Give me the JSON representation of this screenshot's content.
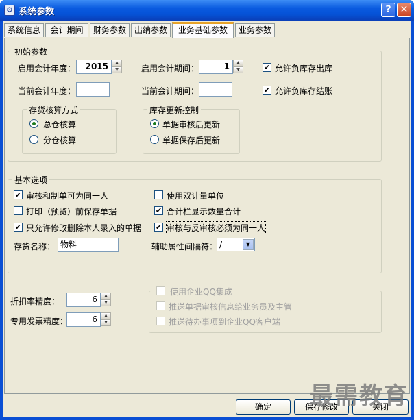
{
  "window": {
    "title": "系统参数",
    "help_glyph": "?",
    "close_glyph": "✕",
    "app_icon_glyph": "⚙"
  },
  "tabs": [
    {
      "label": "系统信息"
    },
    {
      "label": "会计期间"
    },
    {
      "label": "财务参数"
    },
    {
      "label": "出纳参数"
    },
    {
      "label": "业务基础参数",
      "active": true
    },
    {
      "label": "业务参数"
    }
  ],
  "initial": {
    "legend": "初始参数",
    "start_year_label": "启用会计年度：",
    "start_year_value": "2015",
    "start_period_label": "启用会计期间：",
    "start_period_value": "1",
    "current_year_label": "当前会计年度：",
    "current_year_value": "",
    "current_period_label": "当前会计期间：",
    "current_period_value": "",
    "allow_negative_out": {
      "label": "允许负库存出库",
      "checked": true
    },
    "allow_negative_close": {
      "label": "允许负库存结账",
      "checked": true
    },
    "costing": {
      "legend": "存货核算方式",
      "option1": "总仓核算",
      "option2": "分仓核算",
      "selected": "总仓核算"
    },
    "stock_update": {
      "legend": "库存更新控制",
      "option1": "单据审核后更新",
      "option2": "单据保存后更新",
      "selected": "单据审核后更新"
    }
  },
  "basic": {
    "legend": "基本选项",
    "opt_same_person": {
      "label": "审核和制单可为同一人",
      "checked": true
    },
    "opt_dual_unit": {
      "label": "使用双计量单位",
      "checked": false
    },
    "opt_print_save": {
      "label": "打印（预览）前保存单据",
      "checked": false
    },
    "opt_total_qty": {
      "label": "合计栏显示数量合计",
      "checked": true
    },
    "opt_own_docs": {
      "label": "只允许修改删除本人录入的单据",
      "checked": true
    },
    "opt_review_same": {
      "label": "审核与反审核必须为同一人",
      "checked": true
    },
    "inventory_name_label": "存货名称：",
    "inventory_name_value": "物料",
    "separator_label": "辅助属性间隔符：",
    "separator_value": "/"
  },
  "precision": {
    "discount_label": "折扣率精度：",
    "discount_value": "6",
    "invoice_label": "专用发票精度：",
    "invoice_value": "6"
  },
  "qq": {
    "use_qq": {
      "label": "使用企业QQ集成",
      "checked": false
    },
    "push_audit": {
      "label": "推送单据审核信息给业务员及主管",
      "checked": false
    },
    "push_todo": {
      "label": "推送待办事项到企业QQ客户端",
      "checked": false
    }
  },
  "buttons": {
    "ok": "确定",
    "save": "保存修改",
    "close": "关闭"
  },
  "watermark": "最需教育"
}
